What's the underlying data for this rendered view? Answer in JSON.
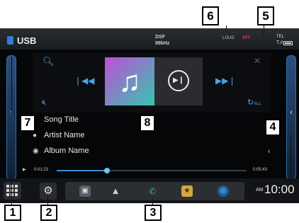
{
  "status": {
    "source_label": "USB",
    "format_line1": "DSF",
    "format_line2": "98kHz",
    "loud_label": "LOUD",
    "att_label": "ATT",
    "tel_label": "TEL"
  },
  "controls": {
    "repeat_mode": "ALL"
  },
  "track": {
    "title": "Song Title",
    "artist": "Artist Name",
    "album": "Album Name",
    "elapsed": "0:01:23",
    "total": "0:05:43",
    "progress_fraction": 0.265
  },
  "dock": {
    "clock_ampm": "AM",
    "clock_time": "10:00",
    "shortcuts": [
      "media-icon",
      "navigation-icon",
      "phone-icon",
      "favorite-icon",
      "audio-icon"
    ]
  },
  "callouts": {
    "c1": "1",
    "c2": "2",
    "c3": "3",
    "c4": "4",
    "c5": "5",
    "c6": "6",
    "c7": "7",
    "c8": "8"
  },
  "colors": {
    "accent_blue": "#4aa3e6",
    "progress_blue": "#3a8fd6",
    "att_red": "#e0413a",
    "phone_green": "#32c35a",
    "favorite_gold": "#d5a640",
    "callout_border": "#000000"
  }
}
